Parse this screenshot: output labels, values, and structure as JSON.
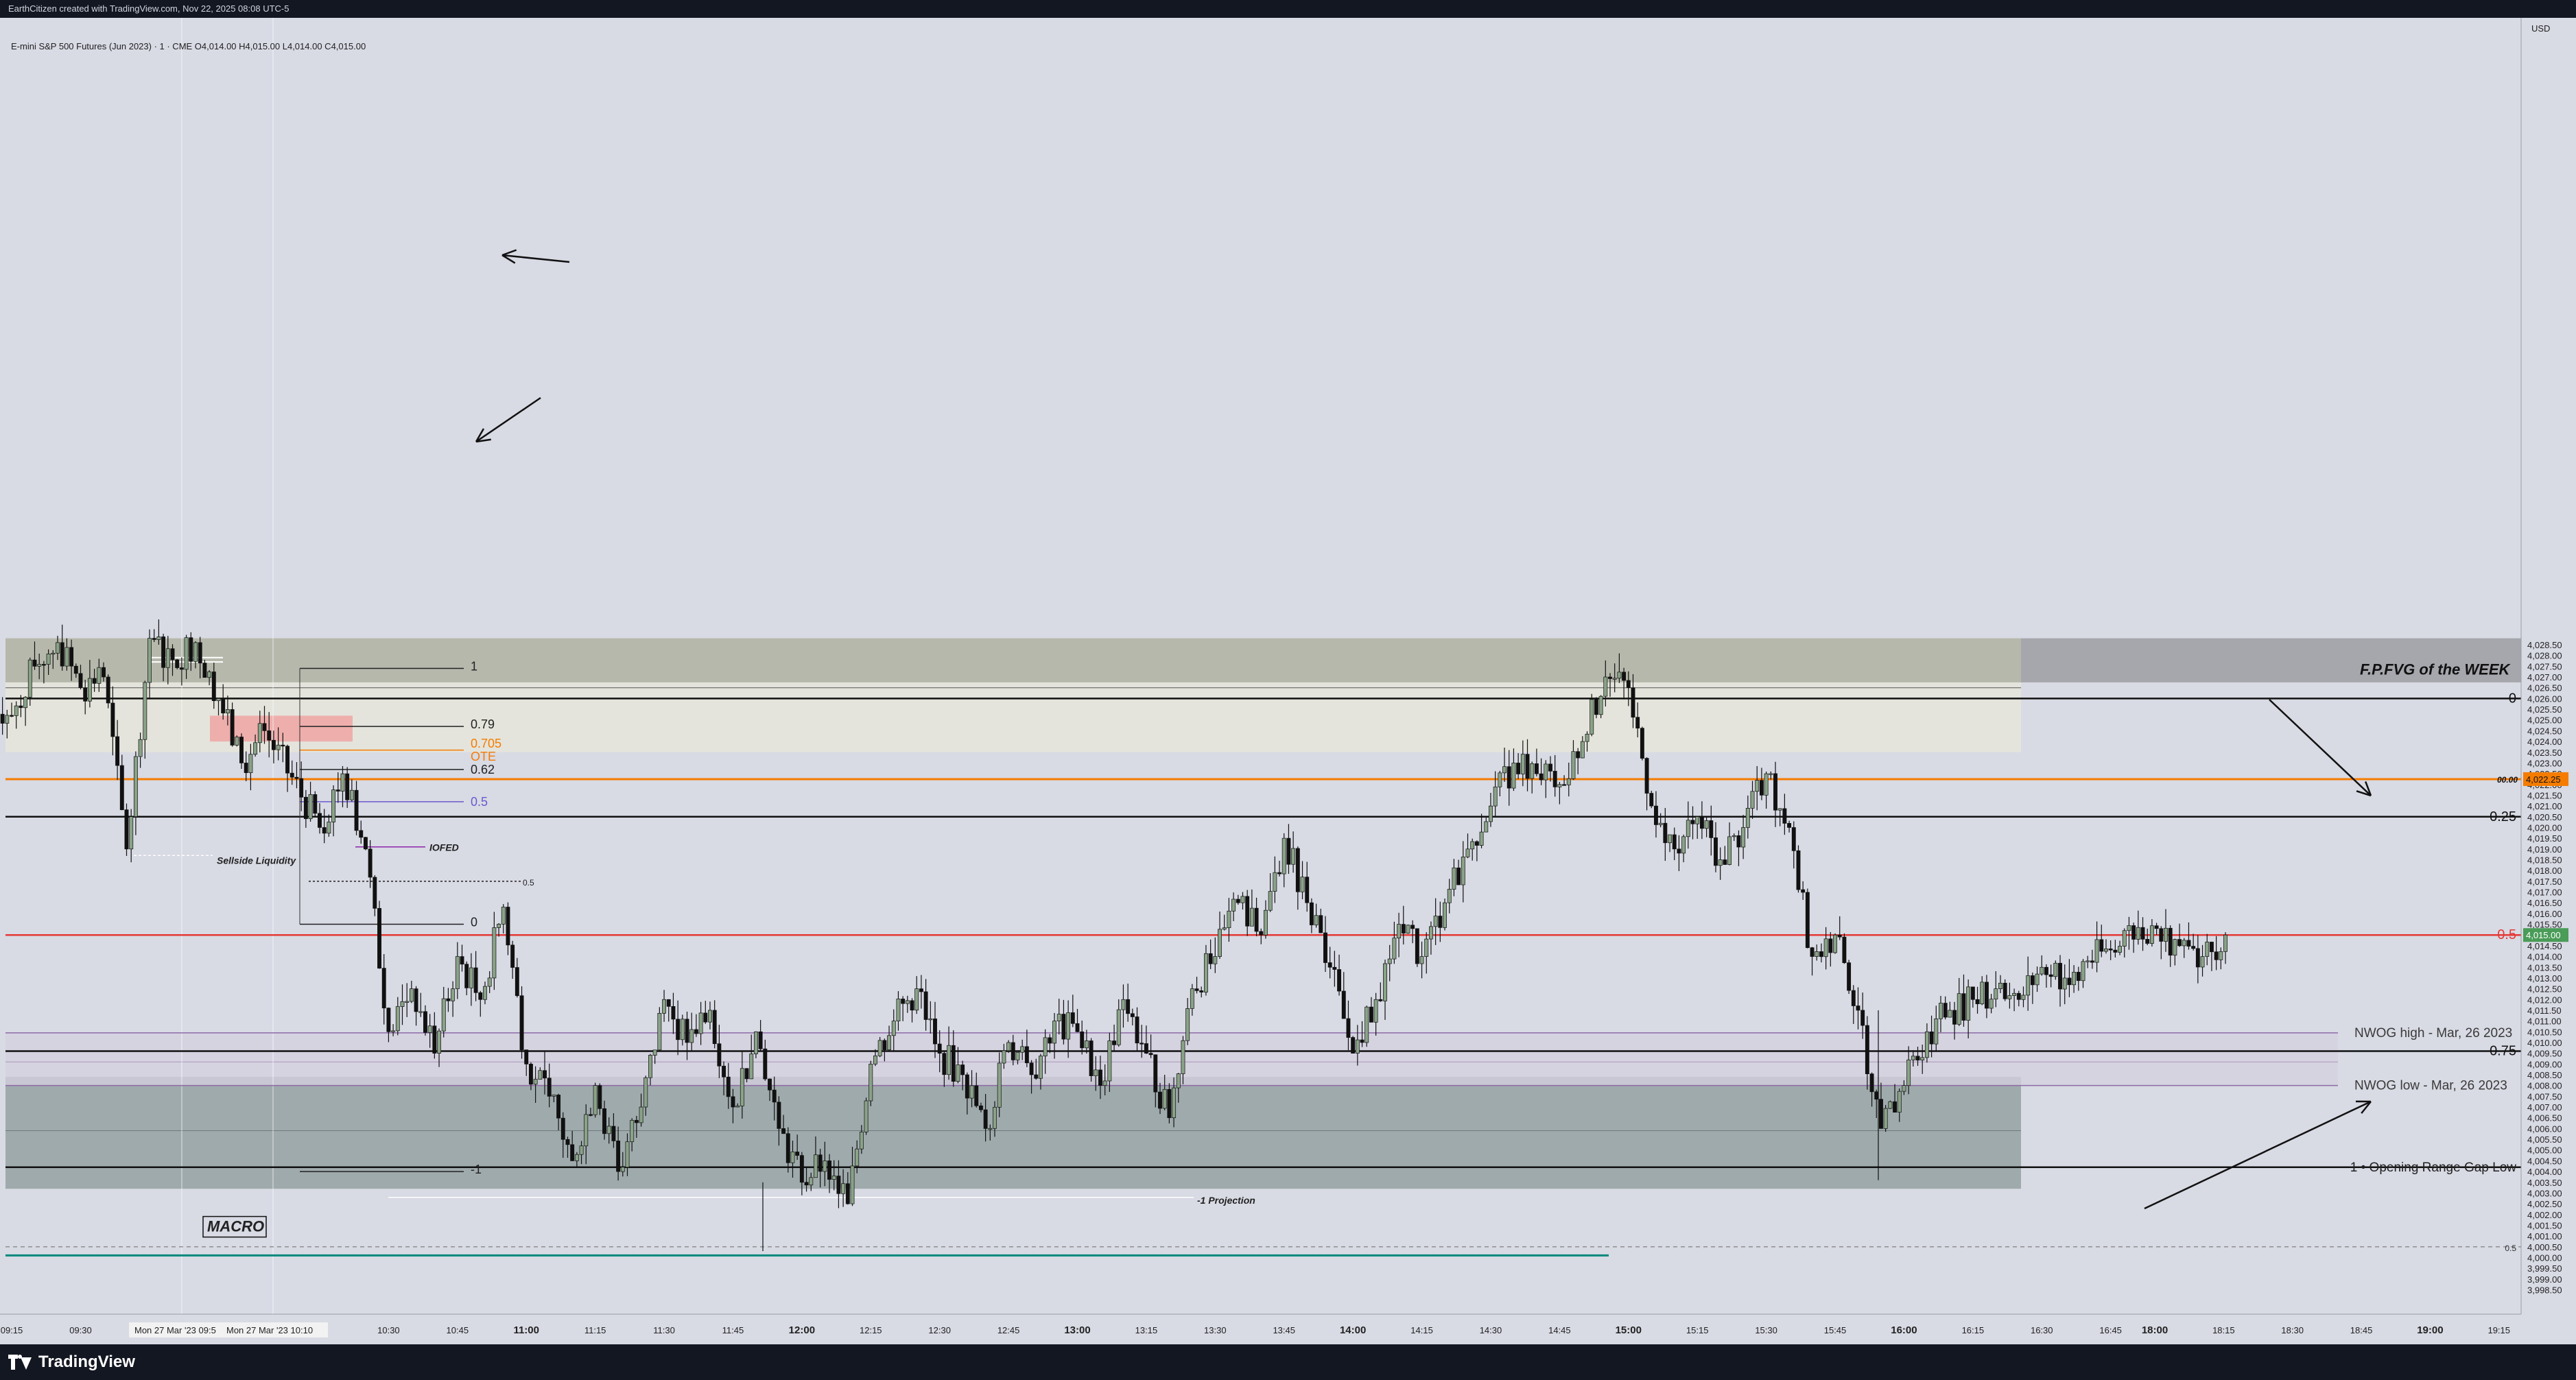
{
  "header": {
    "credit": "EarthCitizen created with TradingView.com, Nov 22, 2025 08:08 UTC-5",
    "symbol_line": "E-mini S&P 500 Futures (Jun 2023) · 1 · CME  O4,014.00  H4,015.00  L4,014.00  C4,015.00"
  },
  "footer": {
    "brand": "TradingView"
  },
  "price_axis": {
    "currency": "USD",
    "ticks": [
      "4,028.50",
      "4,028.00",
      "4,027.50",
      "4,027.00",
      "4,026.50",
      "4,026.00",
      "4,025.50",
      "4,025.00",
      "4,024.50",
      "4,024.00",
      "4,023.50",
      "4,023.00",
      "4,022.50",
      "4,022.00",
      "4,021.50",
      "4,021.00",
      "4,020.50",
      "4,020.00",
      "4,019.50",
      "4,019.00",
      "4,018.50",
      "4,018.00",
      "4,017.50",
      "4,017.00",
      "4,016.50",
      "4,016.00",
      "4,015.50",
      "4,015.00",
      "4,014.50",
      "4,014.00",
      "4,013.50",
      "4,013.00",
      "4,012.50",
      "4,012.00",
      "4,011.50",
      "4,011.00",
      "4,010.50",
      "4,010.00",
      "4,009.50",
      "4,009.00",
      "4,008.50",
      "4,008.00",
      "4,007.50",
      "4,007.00",
      "4,006.50",
      "4,006.00",
      "4,005.50",
      "4,005.00",
      "4,004.50",
      "4,004.00",
      "4,003.50",
      "4,003.00",
      "4,002.50",
      "4,002.00",
      "4,001.50",
      "4,001.00",
      "4,000.50",
      "4,000.00",
      "3,999.50",
      "3,999.00",
      "3,998.50"
    ],
    "current_price_badge": "4,015.00",
    "orange_price_badge": "4,022.25",
    "orange_label": "00.00"
  },
  "time_axis": {
    "ticks": [
      "09:15",
      "09:30",
      "10:30",
      "10:45",
      "11:00",
      "11:15",
      "11:30",
      "11:45",
      "12:00",
      "12:15",
      "12:30",
      "12:45",
      "13:00",
      "13:15",
      "13:30",
      "13:45",
      "14:00",
      "14:15",
      "14:30",
      "14:45",
      "15:00",
      "15:15",
      "15:30",
      "15:45",
      "16:00",
      "16:15",
      "16:30",
      "16:45",
      "18:00",
      "18:15",
      "18:30",
      "18:45",
      "19:00",
      "19:15"
    ],
    "bold_ticks": [
      "11:00",
      "12:00",
      "13:00",
      "14:00",
      "15:00",
      "16:00",
      "18:00",
      "19:00"
    ],
    "range_labels": [
      "Mon 27 Mar '23  09:5",
      "Mon 27 Mar '23  10:10"
    ]
  },
  "annotations": {
    "fpfvg": "F.P.FVG of the WEEK",
    "fib_1": "1",
    "fib_079": "0.79",
    "fib_0705": "0.705",
    "ote": "OTE",
    "fib_062": "0.62",
    "fib_05": "0.5",
    "fib_0": "0",
    "fib_m1": "-1",
    "small_05": "0.5",
    "iofed": "IOFED",
    "sellside": "Sellside Liquidity",
    "macro": "MACRO",
    "projection": "-1 Projection",
    "nwog_high": "NWOG high - Mar, 26 2023",
    "nwog_low": "NWOG low - Mar, 26 2023",
    "right_0": "0",
    "right_025": "0.25",
    "right_05": "0.5",
    "right_075": "0.75",
    "right_1": "1 • Opening Range Gap Low",
    "right_small_05": "0.5"
  },
  "colors": {
    "background": "#d8dae4",
    "up_candle": "#8aa388",
    "down_candle": "#111111",
    "orange": "#f57c00",
    "red": "#e53935",
    "purple": "#8e24aa",
    "teal": "#00897b",
    "fpfvg_zone": "#b6b8ac",
    "upper_zone": "#e4e4dc",
    "lower_zone": "#9faaac",
    "nwog_zone": "#d6d0e0"
  },
  "chart_data": {
    "type": "candlestick",
    "title": "E-mini S&P 500 Futures (Jun 2023) · 1 · CME",
    "timeframe": "1",
    "y_range": [
      3998.3,
      4028.7
    ],
    "last_close": 4015.0,
    "ohlc_path": [
      [
        "09:10",
        4026.0
      ],
      [
        "09:15",
        4025.2
      ],
      [
        "09:20",
        4027.5
      ],
      [
        "09:25",
        4028.6
      ],
      [
        "09:30",
        4026.5
      ],
      [
        "09:35",
        4027.0
      ],
      [
        "09:40",
        4019.0
      ],
      [
        "09:45",
        4028.8
      ],
      [
        "09:50",
        4027.8
      ],
      [
        "09:55",
        4028.6
      ],
      [
        "10:00",
        4026.0
      ],
      [
        "10:05",
        4023.0
      ],
      [
        "10:10",
        4024.5
      ],
      [
        "10:15",
        4020.0
      ],
      [
        "10:20",
        4022.5
      ],
      [
        "10:25",
        4019.0
      ],
      [
        "10:30",
        4010.5
      ],
      [
        "10:35",
        4012.5
      ],
      [
        "10:40",
        4009.5
      ],
      [
        "10:45",
        4014.0
      ],
      [
        "10:50",
        4012.0
      ],
      [
        "10:55",
        4016.3
      ],
      [
        "11:00",
        4009.0
      ],
      [
        "11:05",
        4007.5
      ],
      [
        "11:10",
        4004.5
      ],
      [
        "11:15",
        4008.0
      ],
      [
        "11:20",
        4004.0
      ],
      [
        "11:25",
        4007.0
      ],
      [
        "11:30",
        4012.0
      ],
      [
        "11:35",
        4010.0
      ],
      [
        "11:40",
        4011.5
      ],
      [
        "11:45",
        4007.0
      ],
      [
        "11:50",
        4010.5
      ],
      [
        "11:55",
        4006.0
      ],
      [
        "12:00",
        4003.5
      ],
      [
        "12:05",
        4004.5
      ],
      [
        "12:10",
        4002.5
      ],
      [
        "12:15",
        4009.0
      ],
      [
        "12:20",
        4011.0
      ],
      [
        "12:25",
        4012.5
      ],
      [
        "12:30",
        4009.5
      ],
      [
        "12:35",
        4008.5
      ],
      [
        "12:40",
        4006.0
      ],
      [
        "12:45",
        4010.0
      ],
      [
        "12:50",
        4008.5
      ],
      [
        "12:55",
        4011.0
      ],
      [
        "13:00",
        4010.5
      ],
      [
        "13:05",
        4008.0
      ],
      [
        "13:10",
        4012.0
      ],
      [
        "13:15",
        4009.5
      ],
      [
        "13:20",
        4006.5
      ],
      [
        "13:25",
        4012.5
      ],
      [
        "13:30",
        4014.0
      ],
      [
        "13:35",
        4016.5
      ],
      [
        "13:40",
        4015.0
      ],
      [
        "13:45",
        4019.5
      ],
      [
        "13:50",
        4016.5
      ],
      [
        "13:55",
        4013.5
      ],
      [
        "14:00",
        4009.5
      ],
      [
        "14:05",
        4012.0
      ],
      [
        "14:10",
        4015.5
      ],
      [
        "14:15",
        4014.0
      ],
      [
        "14:20",
        4016.5
      ],
      [
        "14:25",
        4019.0
      ],
      [
        "14:30",
        4021.0
      ],
      [
        "14:35",
        4023.0
      ],
      [
        "14:40",
        4022.5
      ],
      [
        "14:45",
        4022.0
      ],
      [
        "14:50",
        4024.0
      ],
      [
        "14:55",
        4027.0
      ],
      [
        "15:00",
        4026.5
      ],
      [
        "15:05",
        4021.0
      ],
      [
        "15:10",
        4019.0
      ],
      [
        "15:15",
        4020.5
      ],
      [
        "15:20",
        4018.5
      ],
      [
        "15:25",
        4020.0
      ],
      [
        "15:30",
        4022.5
      ],
      [
        "15:35",
        4020.0
      ],
      [
        "15:40",
        4014.0
      ],
      [
        "15:45",
        4015.0
      ],
      [
        "15:50",
        4011.5
      ],
      [
        "15:55",
        4006.0
      ],
      [
        "16:00",
        4008.0
      ],
      [
        "16:05",
        4010.5
      ],
      [
        "16:10",
        4011.5
      ],
      [
        "16:15",
        4012.0
      ],
      [
        "16:20",
        4012.5
      ],
      [
        "16:25",
        4012.0
      ],
      [
        "16:30",
        4013.5
      ],
      [
        "16:35",
        4013.0
      ],
      [
        "16:40",
        4013.8
      ],
      [
        "16:45",
        4014.3
      ],
      [
        "16:50",
        4014.8
      ],
      [
        "16:55",
        4015.3
      ],
      [
        "17:00",
        4014.5
      ],
      [
        "17:05",
        4014.0
      ],
      [
        "17:10",
        4015.0
      ]
    ],
    "levels": [
      {
        "name": "right_0",
        "price": 4026.0
      },
      {
        "name": "orange",
        "price": 4022.25
      },
      {
        "name": "right_025",
        "price": 4020.5
      },
      {
        "name": "right_05",
        "price": 4015.0
      },
      {
        "name": "nwog_high",
        "price": 4010.45
      },
      {
        "name": "right_075",
        "price": 4009.6
      },
      {
        "name": "nwog_low",
        "price": 4008.0
      },
      {
        "name": "right_1",
        "price": 4004.2
      },
      {
        "name": "right_small_05",
        "price": 4000.5
      },
      {
        "name": "teal",
        "price": 4000.1
      }
    ]
  }
}
